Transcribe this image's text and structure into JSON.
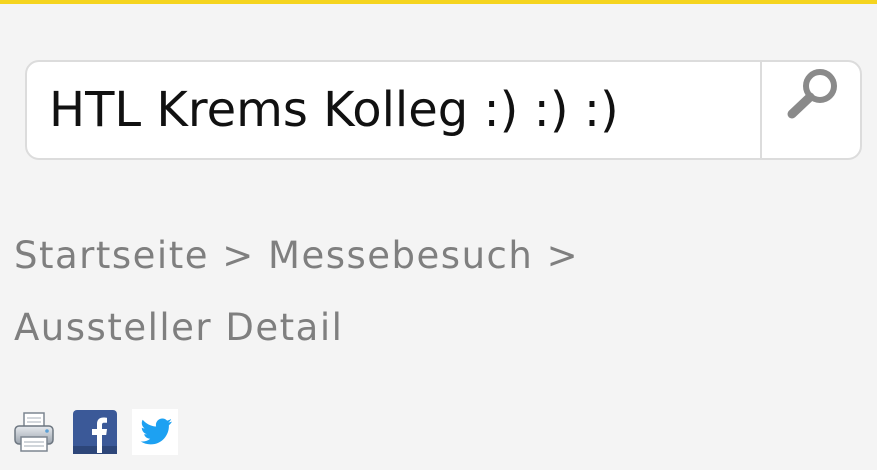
{
  "search": {
    "value": "HTL Krems Kolleg :) :) :)",
    "button_label": "Suche"
  },
  "breadcrumb": {
    "items": [
      {
        "label": "Startseite"
      },
      {
        "label": "Messebesuch"
      },
      {
        "label": "Aussteller Detail"
      }
    ],
    "separator": ">"
  },
  "share": {
    "print_icon": "printer-icon",
    "facebook_icon": "facebook-icon",
    "twitter_icon": "twitter-icon"
  },
  "colors": {
    "accent": "#f5d41f",
    "breadcrumb_text": "#7f7f7f",
    "facebook": "#3b5998",
    "twitter": "#1da1f2"
  }
}
